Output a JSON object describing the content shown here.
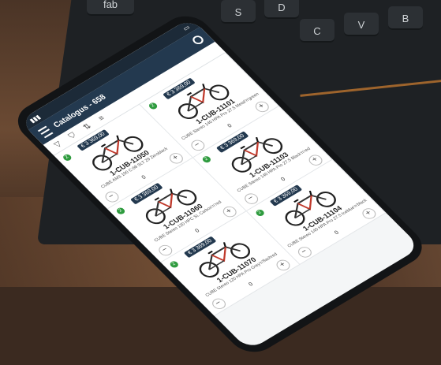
{
  "backdrop": {
    "keys": [
      "fab",
      "S",
      "D",
      "C",
      "V",
      "B"
    ]
  },
  "phone": {
    "app_title": "Catalogus - 658",
    "products": [
      {
        "sku": "1-CUB-11050",
        "price": "€ 3 369,00",
        "desc": "CUBE AMS 100 C:68 SLT 29 Zeroblack",
        "qty": "0",
        "badge": "2"
      },
      {
        "sku": "1-CUB-11101",
        "price": "€ 3 369,00",
        "desc": "CUBE Stereo 140 HPA Pro 27.5 Metal'n'green",
        "qty": "0",
        "badge": "2"
      },
      {
        "sku": "1-CUB-11060",
        "price": "€ 3 369,00",
        "desc": "CUBE Stereo 120 HPC SL Carbon'n'red",
        "qty": "0",
        "badge": "2"
      },
      {
        "sku": "1-CUB-11103",
        "price": "€ 3 369,00",
        "desc": "CUBE Stereo 140 HPA Pro 27.5 Black'n'red",
        "qty": "0",
        "badge": "2"
      },
      {
        "sku": "1-CUB-11070",
        "price": "€ 3 369,00",
        "desc": "CUBE Stereo 120 HPA Pro Grey'n'flashred",
        "qty": "0",
        "badge": "2"
      },
      {
        "sku": "1-CUB-11104",
        "price": "€ 3 369,00",
        "desc": "CUBE Stereo 140 HPA Pro 27.5 Iceblue'n'black",
        "qty": "0",
        "badge": "2"
      }
    ]
  },
  "colors": {
    "appbar": "#23394f",
    "badge": "#2e9b3e"
  }
}
